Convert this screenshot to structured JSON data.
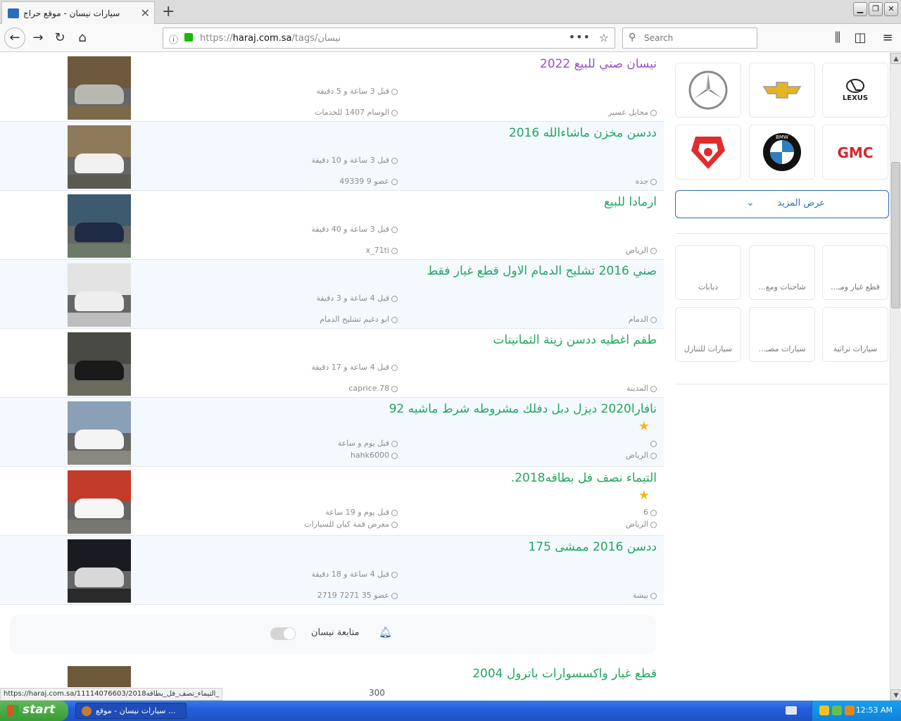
{
  "browser": {
    "tab_title": "سيارات نيسان - موقع حراج",
    "url_prefix": "https://",
    "url_domain": "haraj.com.sa",
    "url_path": "/tags/نيسان",
    "search_placeholder": "Search"
  },
  "listings": [
    {
      "title": "نيسان صني للبيع 2022",
      "visited": true,
      "time": "قبل 3 ساعة و 5 دقيقة",
      "user": "الوسام 1407 للخدمات",
      "city": "محايل عسير",
      "star": false,
      "likes": ""
    },
    {
      "title": "ددسن مخزن ماشاءالله 2016",
      "visited": false,
      "time": "قبل 3 ساعة و 10 دقيقة",
      "user": "عضو 9 49339",
      "city": "جده",
      "star": false,
      "likes": ""
    },
    {
      "title": "ارمادا للبيع",
      "visited": false,
      "time": "قبل 3 ساعة و 40 دقيقة",
      "user": "x_71ti",
      "city": "الرياض",
      "star": false,
      "likes": ""
    },
    {
      "title": "صني 2016 تشليح الدمام الاول قطع غيار فقط",
      "visited": false,
      "time": "قبل 4 ساعة و 3 دقيقة",
      "user": "ابو دغيم تشليح الدمام",
      "city": "الدمام",
      "star": false,
      "likes": ""
    },
    {
      "title": "طقم اغطيه ددسن زينة الثمانينات",
      "visited": false,
      "time": "قبل 4 ساعة و 17 دقيقة",
      "user": "caprice.78",
      "city": "المدينة",
      "star": false,
      "likes": ""
    },
    {
      "title": "نافارا2020 ديزل دبل دفلك مشروطه شرط ماشيه 92",
      "visited": false,
      "time": "قبل يوم و ساعة",
      "user": "hahk6000",
      "city": "الرياض",
      "star": true,
      "likes": ""
    },
    {
      "title": "التيماء نصف فل بطاقه2018.",
      "visited": false,
      "time": "قبل يوم و 19 ساعة",
      "user": "معرض قمة كيان للسيارات",
      "city": "الرياض",
      "star": true,
      "likes": "6"
    },
    {
      "title": "ددسن 2016 ممشى 175",
      "visited": false,
      "time": "قبل 4 ساعة و 18 دقيقة",
      "user": "عضو 35 7271 2719",
      "city": "بيشة",
      "star": false,
      "likes": ""
    },
    {
      "title": "قطع غيار واكسسوارات باترول 2004",
      "visited": false,
      "time": "",
      "user": "",
      "city": "",
      "star": false,
      "likes": ""
    }
  ],
  "follow": {
    "label": "متابعة نيسان"
  },
  "sidebar": {
    "brands": [
      {
        "name": "mercedes-logo"
      },
      {
        "name": "chevrolet-logo"
      },
      {
        "name": "lexus-logo",
        "text": "LEXUS"
      },
      {
        "name": "dodge-ram-logo"
      },
      {
        "name": "bmw-logo",
        "text": "BMW"
      },
      {
        "name": "gmc-logo",
        "text": "GMC"
      }
    ],
    "show_more": "عرض المزيد",
    "categories": [
      "دبابات",
      "شاحنات ومع...",
      "قطع غيار ومـ...",
      "سيارات للتنازل",
      "سيارات مصـ...",
      "سيارات تراثية"
    ]
  },
  "status": {
    "link": "https://haraj.com.sa/11114076603/التيماء_نصف_فل_بطاقه2018_",
    "views": "300"
  },
  "taskbar": {
    "start": "start",
    "task": "سيارات نيسان - موقع ...",
    "clock": "12:53 AM"
  },
  "colors": {
    "title_green": "#21a65f",
    "visited_purple": "#9b4fc7",
    "accent_blue": "#2a6fb6",
    "star_gold": "#f2b81a"
  }
}
